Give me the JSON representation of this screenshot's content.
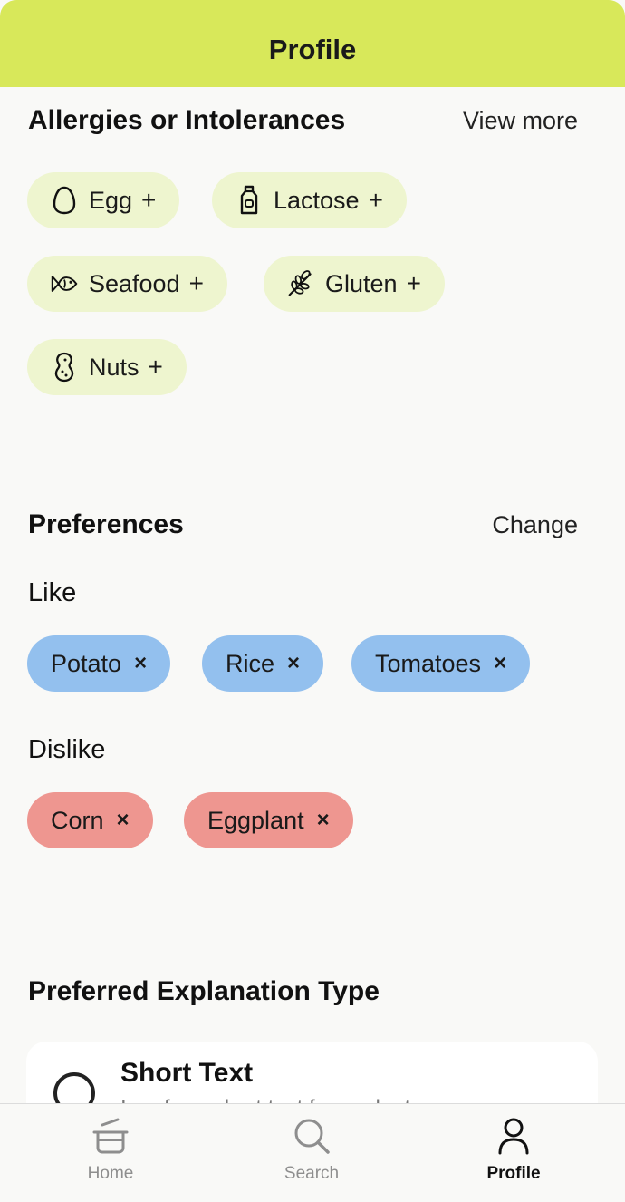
{
  "header": {
    "title": "Profile"
  },
  "allergies": {
    "title": "Allergies or Intolerances",
    "link": "View more",
    "items": [
      {
        "label": "Egg",
        "mark": "+",
        "icon": "egg-icon"
      },
      {
        "label": "Lactose",
        "mark": "+",
        "icon": "milk-bottle-icon"
      },
      {
        "label": "Seafood",
        "mark": "+",
        "icon": "fish-icon"
      },
      {
        "label": "Gluten",
        "mark": "+",
        "icon": "wheat-icon"
      },
      {
        "label": "Nuts",
        "mark": "+",
        "icon": "peanut-icon"
      }
    ]
  },
  "preferences": {
    "title": "Preferences",
    "link": "Change",
    "like_label": "Like",
    "likes": [
      {
        "label": "Potato",
        "mark": "×"
      },
      {
        "label": "Rice",
        "mark": "×"
      },
      {
        "label": "Tomatoes",
        "mark": "×"
      }
    ],
    "dislike_label": "Dislike",
    "dislikes": [
      {
        "label": "Corn",
        "mark": "×"
      },
      {
        "label": "Eggplant",
        "mark": "×"
      }
    ]
  },
  "explanation": {
    "title": "Preferred Explanation Type",
    "option": {
      "title": "Short Text",
      "description": "I prefer a short text for each step"
    }
  },
  "tabs": [
    {
      "label": "Home",
      "icon": "cooking-pot-icon"
    },
    {
      "label": "Search",
      "icon": "search-icon"
    },
    {
      "label": "Profile",
      "icon": "user-icon",
      "active": true
    }
  ],
  "colors": {
    "header": "#d8e85a",
    "allergy_chip": "#eef5cf",
    "like_chip": "#93c0ee",
    "dislike_chip": "#ee9690",
    "background": "#f9f9f7"
  }
}
